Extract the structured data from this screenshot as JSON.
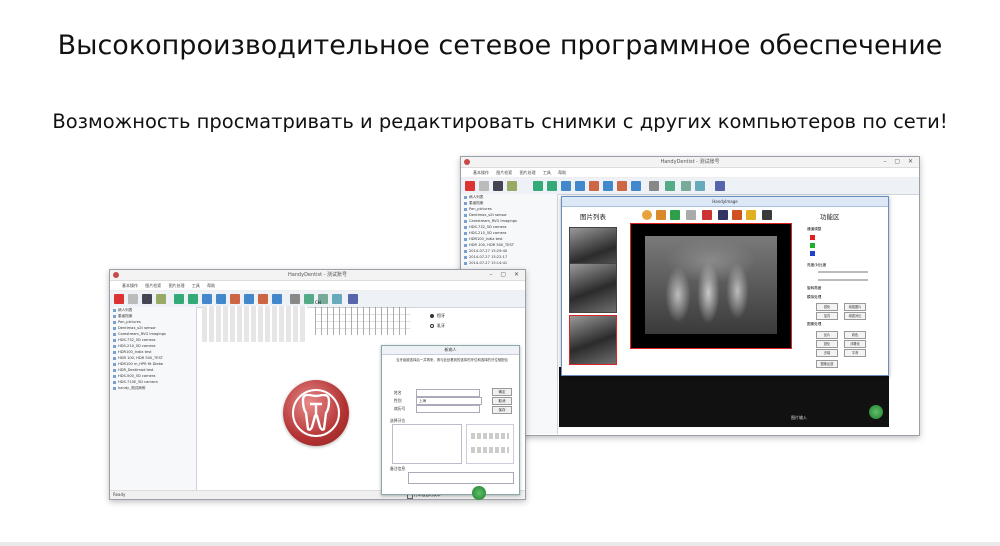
{
  "headline": "Высокопроизводительное сетевое программное обеспечение",
  "subheadline": "Возможность просматривать и редактировать снимки с других компьютеров по сети!",
  "back_window": {
    "title": "HandyDentist - 测试账号",
    "menu": [
      "基本操作",
      "图片检索",
      "图片处理",
      "工具",
      "帮助"
    ],
    "sidebar_title": "病人列表",
    "sidebar_items": [
      "患者档案",
      "Pan_pictures",
      "Dentimax_s2t sensor",
      "Carestream_RVG Imagings",
      "HDS-732_5D camera",
      "HDS-210_5D camera",
      "HDR100_India test",
      "HDR 100, HDR 500_TEST",
      "2014-07-27 15:29:40",
      "2014-07-27 15:22:17",
      "2014-07-27 15:14:41"
    ],
    "status": "图片输入"
  },
  "viewer": {
    "title": "HandyImage",
    "list_header": "图片列表",
    "function_header": "功能区",
    "sections": [
      "通道调整",
      "亮度/对比度",
      "旋转角度",
      "模拟处理",
      "图像处理"
    ],
    "buttons": [
      "锐化",
      "增强图片",
      "加亮",
      "增强对比",
      "反片",
      "着色",
      "锐化",
      "浮雕化",
      "去噪",
      "平滑",
      "图像反选"
    ],
    "colors": {
      "red": "#e02020",
      "green": "#20b030",
      "blue": "#2040d0"
    }
  },
  "front_window": {
    "title": "HandyDentist - 测试账号",
    "menu": [
      "基本操作",
      "图片检索",
      "图片处理",
      "工具",
      "帮助"
    ],
    "sidebar_title": "病人列表",
    "sidebar_items": [
      "患者档案",
      "Pan_pictures",
      "Dentimax_s2t sensor",
      "Carestream_RVG Imagings",
      "HDS-732_5D camera",
      "HDS-210_5D camera",
      "HDR100_India test",
      "HDR 100, HDR 500_TEST",
      "HDR100 m_HPR fit Diebe",
      "HDR_Dentimad test",
      "HDS-500_5D camera",
      "HDS-710E_5D camera",
      "handy_测试病例"
    ],
    "chart_label": "CH",
    "radio_adult": "恒牙",
    "radio_child": "乳牙",
    "status": "Ready",
    "footer_checkbox": "打印报告时表单"
  },
  "dialog": {
    "title": "新病人",
    "note": "当牙齿被选择后一并再来，请与此处看到的选择的牙位和选择的牙位相配合",
    "label_name": "姓名",
    "label_gender": "性别",
    "label_note": "病历号",
    "value_gender": "上海",
    "section_teeth": "选择牙位",
    "section_notes": "备注信息",
    "btn_ok": "确定",
    "btn_cancel": "取消",
    "btn_save": "保存"
  }
}
